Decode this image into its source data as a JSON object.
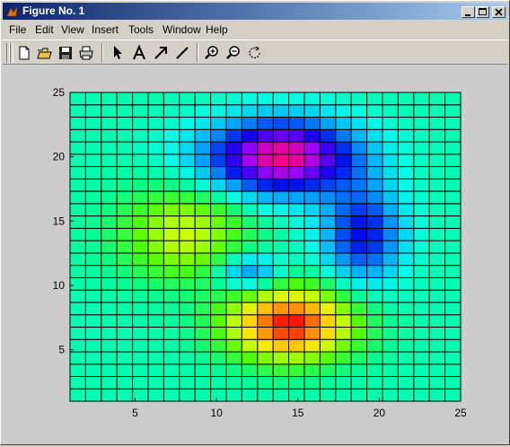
{
  "window": {
    "title": "Figure No. 1"
  },
  "menubar": {
    "items": [
      "File",
      "Edit",
      "View",
      "Insert",
      "Tools",
      "Window",
      "Help"
    ]
  },
  "toolbar": {
    "tools": [
      "new-file-icon",
      "open-folder-icon",
      "save-icon",
      "print-icon",
      "select-arrow-icon",
      "text-A-icon",
      "arrow-icon",
      "line-icon",
      "zoom-in-icon",
      "zoom-out-icon",
      "rotate-icon"
    ]
  },
  "chart_data": {
    "type": "heatmap",
    "title": "",
    "xlabel": "",
    "ylabel": "",
    "xlim": [
      1,
      25
    ],
    "ylim": [
      1,
      25
    ],
    "xticks": [
      5,
      10,
      15,
      20,
      25
    ],
    "yticks": [
      5,
      10,
      15,
      20,
      25
    ],
    "grid_size": [
      25,
      25
    ],
    "colormap": "hsv",
    "features": [
      {
        "x": 14.5,
        "y": 7,
        "sx": 2.6,
        "sy": 1.9,
        "amp": 1.0
      },
      {
        "x": 8,
        "y": 14,
        "sx": 2.6,
        "sy": 2.4,
        "amp": 0.45
      },
      {
        "x": 14,
        "y": 20,
        "sx": 3.2,
        "sy": 2.0,
        "amp": -1.0
      },
      {
        "x": 19,
        "y": 14,
        "sx": 1.7,
        "sy": 2.6,
        "amp": -0.55
      },
      {
        "x": 12,
        "y": 11,
        "sx": 1.4,
        "sy": 1.0,
        "amp": -0.4
      }
    ],
    "colors": {
      "background": "#cccccc",
      "grid": "#000000"
    }
  }
}
